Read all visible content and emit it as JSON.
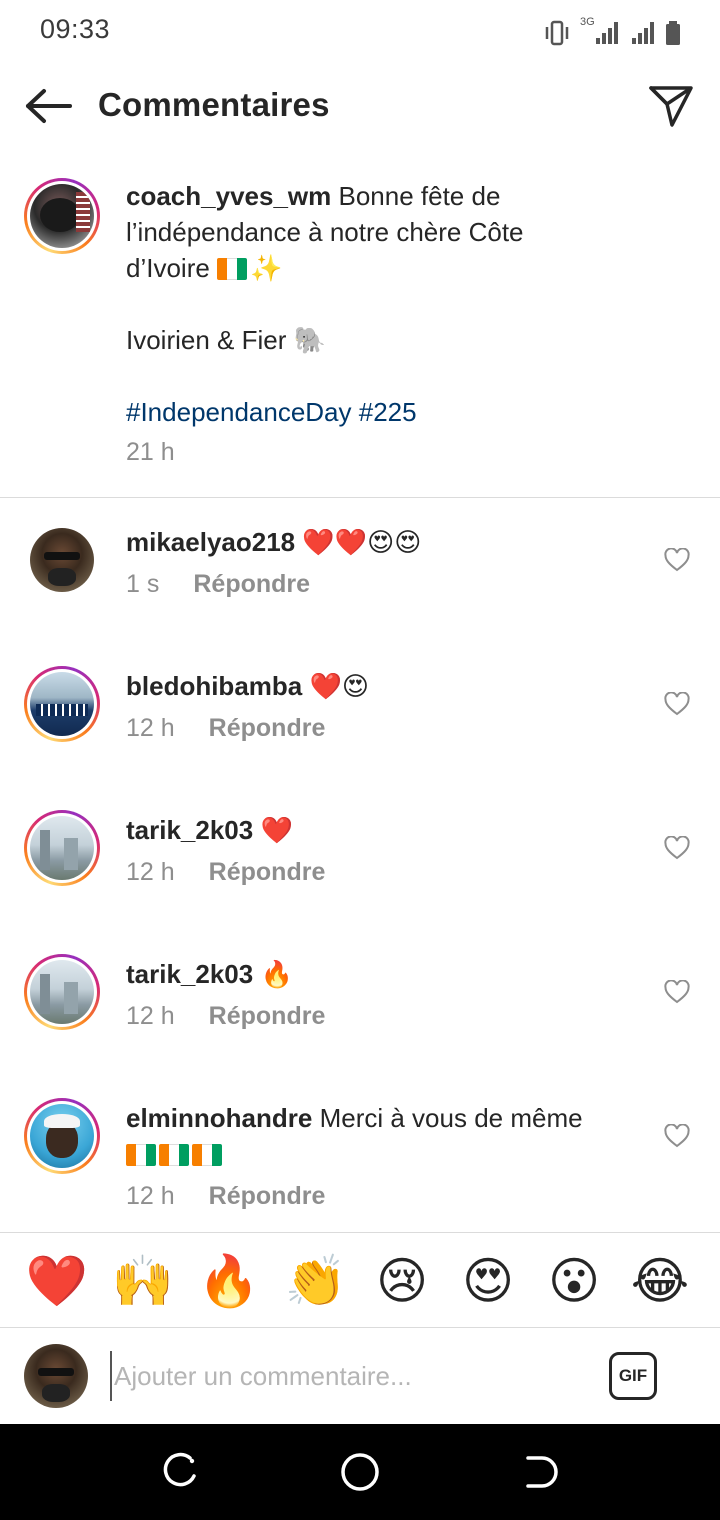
{
  "status": {
    "time": "09:33",
    "network": "3G"
  },
  "header": {
    "title": "Commentaires",
    "back_icon": "arrow-left-icon",
    "share_icon": "paper-plane-icon"
  },
  "caption": {
    "username": "coach_yves_wm",
    "text": "Bonne fête de l’indépendance à notre chère Côte d’Ivoire",
    "line2": "Ivoirien & Fier",
    "hashtags": "#IndependanceDay #225",
    "time": "21 h"
  },
  "comments": [
    {
      "username": "mikaelyao218",
      "text": "",
      "emojis": "❤️❤️😍😍",
      "time": "1 s",
      "reply_label": "Répondre"
    },
    {
      "username": "bledohibamba",
      "text": "",
      "emojis": "❤️😍",
      "time": "12 h",
      "reply_label": "Répondre"
    },
    {
      "username": "tarik_2k03",
      "text": "",
      "emojis": "❤️",
      "time": "12 h",
      "reply_label": "Répondre"
    },
    {
      "username": "tarik_2k03",
      "text": "",
      "emojis": "🔥",
      "time": "12 h",
      "reply_label": "Répondre"
    },
    {
      "username": "elminnohandre",
      "text": "Merci à vous de même",
      "emojis": "",
      "time": "12 h",
      "reply_label": "Répondre"
    }
  ],
  "emoji_bar": [
    "❤️",
    "🙌",
    "🔥",
    "👏",
    "😢",
    "😍",
    "😮",
    "😂"
  ],
  "input": {
    "placeholder": "Ajouter un commentaire...",
    "gif_label": "GIF"
  },
  "colors": {
    "link": "#00376b",
    "muted": "#8e8e8e",
    "text": "#262626",
    "divider": "#dbdbdb"
  }
}
